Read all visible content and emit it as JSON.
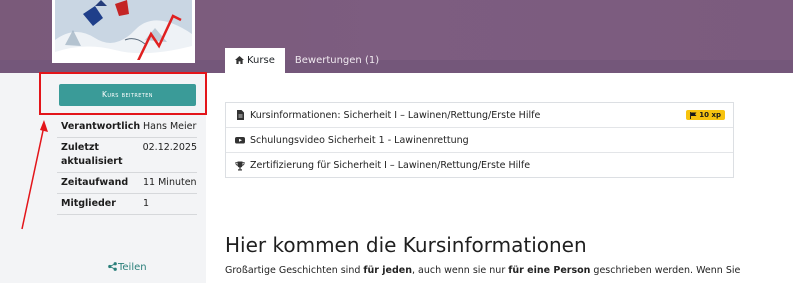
{
  "tabs": {
    "courses": "Kurse",
    "reviews": "Bewertungen (1)"
  },
  "sidebar": {
    "join_button": "Kurs beitreten",
    "info": [
      {
        "key": "Verantwortlich",
        "value": "Hans Meier"
      },
      {
        "key": "Zuletzt aktualisiert",
        "value": "02.12.2025"
      },
      {
        "key": "Zeitaufwand",
        "value": "11 Minuten"
      },
      {
        "key": "Mitglieder",
        "value": "1"
      }
    ],
    "share": "Teilen"
  },
  "content": {
    "items": [
      {
        "label": "Kursinformationen: Sicherheit I – Lawinen/Rettung/Erste Hilfe",
        "icon": "file-icon",
        "badge": "10 xp"
      },
      {
        "label": "Schulungsvideo Sicherheit 1 - Lawinenrettung",
        "icon": "youtube-icon"
      },
      {
        "label": "Zertifizierung für Sicherheit I – Lawinen/Rettung/Erste Hilfe",
        "icon": "trophy-icon"
      }
    ]
  },
  "intro": {
    "heading": "Hier kommen die Kursinformationen",
    "p_1": "Großartige Geschichten sind ",
    "p_2": "für jeden",
    "p_3": ", auch wenn sie nur ",
    "p_4": "für eine Person",
    "p_5": " geschrieben werden. Wenn Sie"
  },
  "colors": {
    "header": "#7a5a7a",
    "accent": "#3a9b98",
    "badge": "#f7c30f",
    "highlight": "#e3151a"
  }
}
